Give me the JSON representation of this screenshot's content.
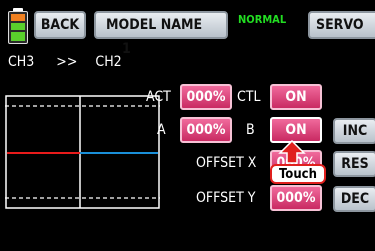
{
  "header": {
    "back_label": "BACK",
    "model_name_label": "MODEL NAME",
    "model_number": "1",
    "status_label": "NORMAL",
    "right_button_label": "SERVO"
  },
  "route": {
    "from": "CH3",
    "arrow": ">>",
    "to": "CH2"
  },
  "rows": {
    "act_label": "ACT",
    "act_value": "000%",
    "ctl_label": "CTL",
    "ctl_value": "ON",
    "a_label": "A",
    "a_value": "000%",
    "b_label": "B",
    "b_value": "ON",
    "offset_x_label": "OFFSET X",
    "offset_x_value": "000%",
    "offset_y_label": "OFFSET Y",
    "offset_y_value": "000%"
  },
  "side_buttons": {
    "inc": "INC",
    "res": "RES",
    "dec": "DEC"
  },
  "touch_hint": "Touch",
  "colors": {
    "status": "#22dd22",
    "graph_left_line": "#e81b1b",
    "graph_right_line": "#1a8fd8",
    "battery_fill": "#5ad02c"
  }
}
